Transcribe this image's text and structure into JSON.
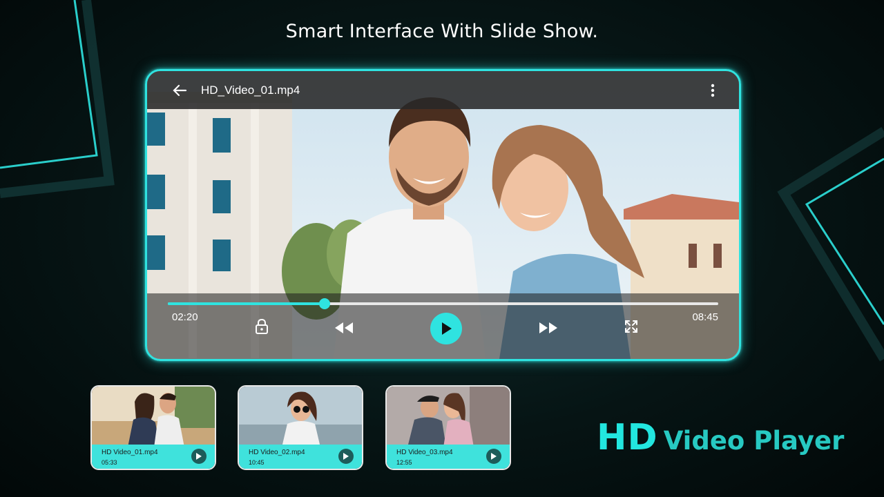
{
  "headline": "Smart Interface With Slide Show.",
  "player": {
    "title": "HD_Video_01.mp4",
    "current_time": "02:20",
    "total_time": "08:45",
    "progress": 0.285,
    "icons": {
      "back": "arrow-left-icon",
      "more": "more-vertical-icon",
      "lock": "lock-icon",
      "rewind": "rewind-icon",
      "play": "play-icon",
      "forward": "fast-forward-icon",
      "fullscreen": "fullscreen-icon"
    }
  },
  "thumbnails": [
    {
      "name": "HD Video_01.mp4",
      "duration": "05:33"
    },
    {
      "name": "HD Video_02.mp4",
      "duration": "10:45"
    },
    {
      "name": "HD Video_03.mp4",
      "duration": "12:55"
    }
  ],
  "brand": {
    "hd": "HD",
    "rest": "Video Player"
  },
  "colors": {
    "accent": "#2fe3e0",
    "thumb_bar": "#3fe2dc",
    "background": "#061414"
  }
}
